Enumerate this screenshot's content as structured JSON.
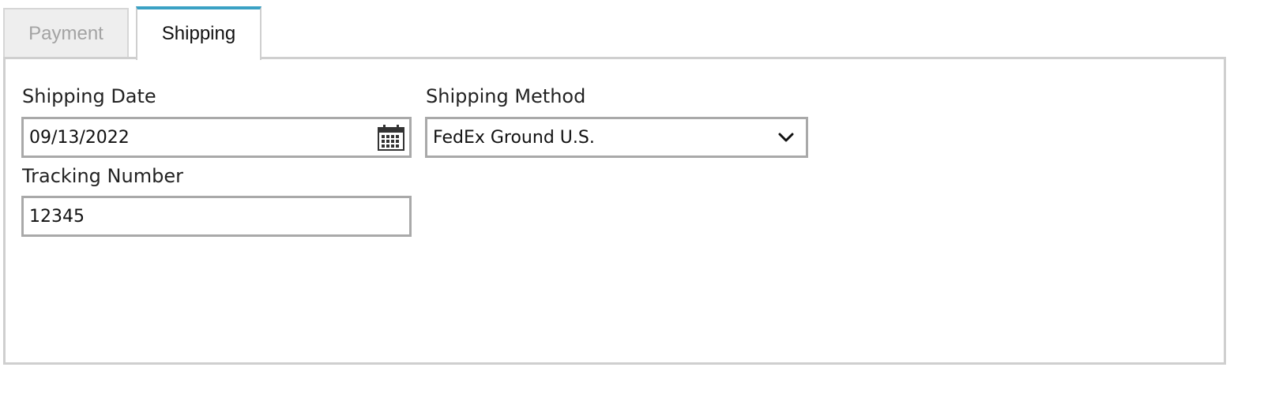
{
  "tabs": [
    {
      "label": "Payment",
      "active": false
    },
    {
      "label": "Shipping",
      "active": true
    }
  ],
  "form": {
    "shipping_date": {
      "label": "Shipping Date",
      "value": "09/13/2022"
    },
    "shipping_method": {
      "label": "Shipping Method",
      "value": "FedEx Ground U.S."
    },
    "tracking_number": {
      "label": "Tracking Number",
      "value": "12345"
    }
  },
  "colors": {
    "active_tab_accent": "#3aa1c4",
    "panel_border": "#cfcfcf",
    "input_border": "#a9a9a9",
    "inactive_tab_bg": "#eeeeee"
  },
  "icons": {
    "date_picker": "calendar-icon",
    "method_dropdown": "chevron-down-icon"
  }
}
